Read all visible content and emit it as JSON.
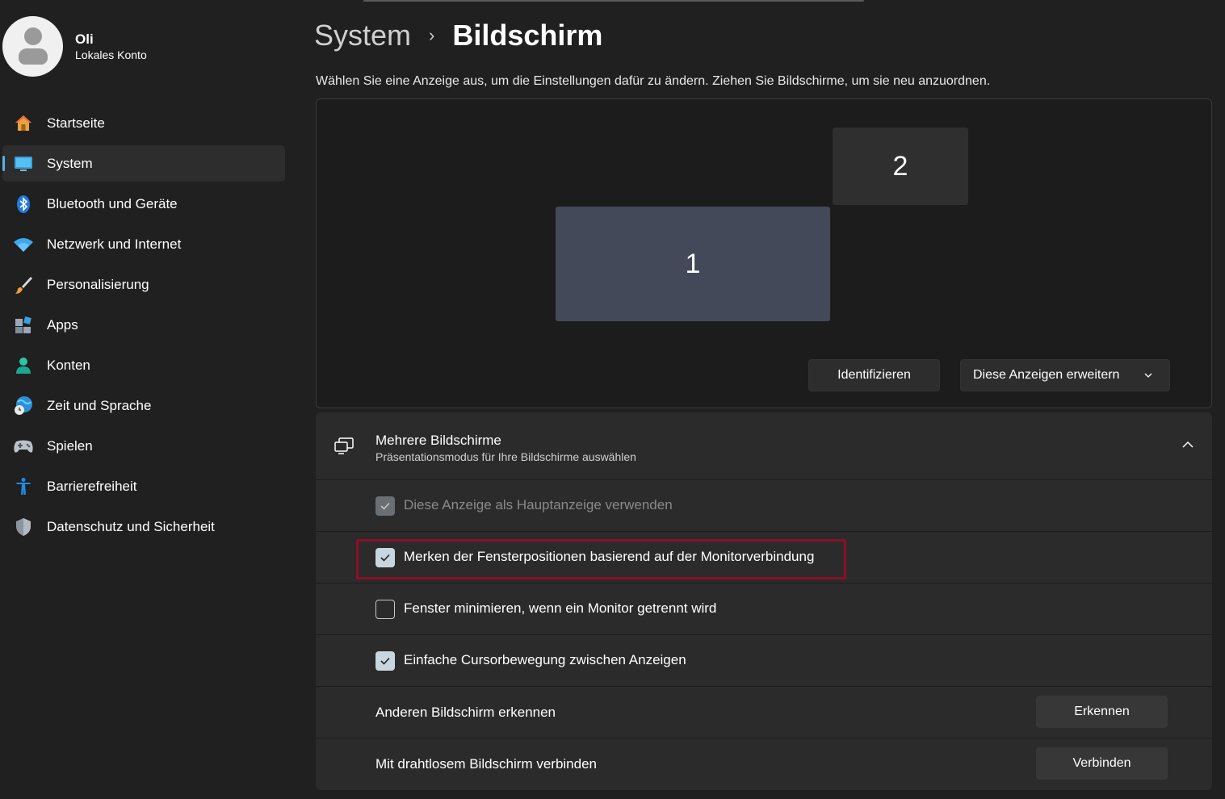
{
  "profile": {
    "name": "Oli",
    "account_type": "Lokales Konto"
  },
  "nav": {
    "items": [
      {
        "label": "Startseite",
        "icon": "home-icon"
      },
      {
        "label": "System",
        "icon": "system-monitor-icon",
        "active": true
      },
      {
        "label": "Bluetooth und Geräte",
        "icon": "bluetooth-icon"
      },
      {
        "label": "Netzwerk und Internet",
        "icon": "wifi-icon"
      },
      {
        "label": "Personalisierung",
        "icon": "brush-icon"
      },
      {
        "label": "Apps",
        "icon": "apps-icon"
      },
      {
        "label": "Konten",
        "icon": "account-icon"
      },
      {
        "label": "Zeit und Sprache",
        "icon": "globe-clock-icon"
      },
      {
        "label": "Spielen",
        "icon": "gamepad-icon"
      },
      {
        "label": "Barrierefreiheit",
        "icon": "accessibility-icon"
      },
      {
        "label": "Datenschutz und Sicherheit",
        "icon": "shield-icon"
      }
    ]
  },
  "breadcrumb": {
    "parent": "System",
    "separator": "›",
    "current": "Bildschirm"
  },
  "subtitle": "Wählen Sie eine Anzeige aus, um die Einstellungen dafür zu ändern. Ziehen Sie Bildschirme, um sie neu anzuordnen.",
  "arrangement": {
    "monitors": [
      {
        "number": "1",
        "selected": true
      },
      {
        "number": "2",
        "selected": false
      }
    ],
    "identify_button": "Identifizieren",
    "mode_dropdown": "Diese Anzeigen erweitern"
  },
  "multiple_displays": {
    "title": "Mehrere Bildschirme",
    "subtitle": "Präsentationsmodus für Ihre Bildschirme auswählen",
    "options": [
      {
        "label": "Diese Anzeige als Hauptanzeige verwenden",
        "checked": true,
        "disabled": true
      },
      {
        "label": "Merken der Fensterpositionen basierend auf der Monitorverbindung",
        "checked": true,
        "disabled": false
      },
      {
        "label": "Fenster minimieren, wenn ein Monitor getrennt wird",
        "checked": false,
        "disabled": false
      },
      {
        "label": "Einfache Cursorbewegung zwischen Anzeigen",
        "checked": true,
        "disabled": false
      }
    ],
    "detect": {
      "label": "Anderen Bildschirm erkennen",
      "button": "Erkennen"
    },
    "wireless": {
      "label": "Mit drahtlosem Bildschirm verbinden",
      "button": "Verbinden"
    }
  },
  "colors": {
    "background": "#202020",
    "accent": "#5ab0e8",
    "highlight_border": "#8a1027",
    "monitor_selected": "#434958"
  }
}
